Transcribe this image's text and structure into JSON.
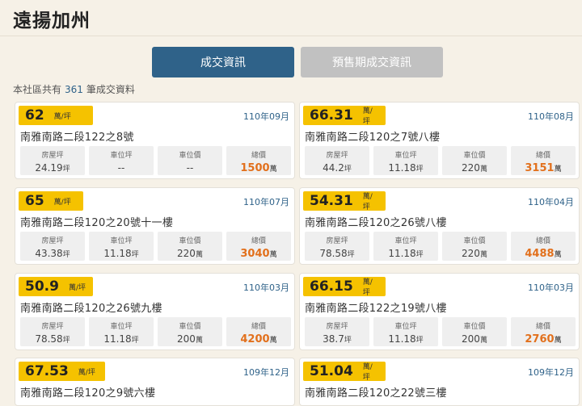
{
  "page": {
    "title": "遠揚加州"
  },
  "tabs": [
    {
      "label": "成交資訊",
      "active": true
    },
    {
      "label": "預售期成交資訊",
      "active": false
    }
  ],
  "summary": {
    "prefix": "本社區共有",
    "count": "361",
    "suffix": "筆成交資料"
  },
  "labels": {
    "house_area": "房屋坪",
    "parking_area": "車位坪",
    "parking_price": "車位價",
    "total_price": "總價",
    "unit_ping": "坪",
    "unit_wan": "萬",
    "price_unit": "萬/坪"
  },
  "colors": {
    "accent_blue": "#2f6289",
    "badge_yellow": "#f5c200",
    "total_orange": "#e2701c",
    "inactive_tab": "#c1c1c1"
  },
  "listings": [
    {
      "price": "62",
      "date": "110年09月",
      "address": "南雅南路二段122之8號",
      "house_area": "24.19",
      "parking_area": "--",
      "parking_price": "--",
      "total": "1500"
    },
    {
      "price": "66.31",
      "date": "110年08月",
      "address": "南雅南路二段120之7號八樓",
      "house_area": "44.2",
      "parking_area": "11.18",
      "parking_price": "220",
      "total": "3151"
    },
    {
      "price": "65",
      "date": "110年07月",
      "address": "南雅南路二段120之20號十一樓",
      "house_area": "43.38",
      "parking_area": "11.18",
      "parking_price": "220",
      "total": "3040"
    },
    {
      "price": "54.31",
      "date": "110年04月",
      "address": "南雅南路二段120之26號八樓",
      "house_area": "78.58",
      "parking_area": "11.18",
      "parking_price": "220",
      "total": "4488"
    },
    {
      "price": "50.9",
      "date": "110年03月",
      "address": "南雅南路二段120之26號九樓",
      "house_area": "78.58",
      "parking_area": "11.18",
      "parking_price": "200",
      "total": "4200"
    },
    {
      "price": "66.15",
      "date": "110年03月",
      "address": "南雅南路二段122之19號八樓",
      "house_area": "38.7",
      "parking_area": "11.18",
      "parking_price": "200",
      "total": "2760"
    },
    {
      "price": "67.53",
      "date": "109年12月",
      "address": "南雅南路二段120之9號六樓"
    },
    {
      "price": "51.04",
      "date": "109年12月",
      "address": "南雅南路二段120之22號三樓"
    }
  ]
}
